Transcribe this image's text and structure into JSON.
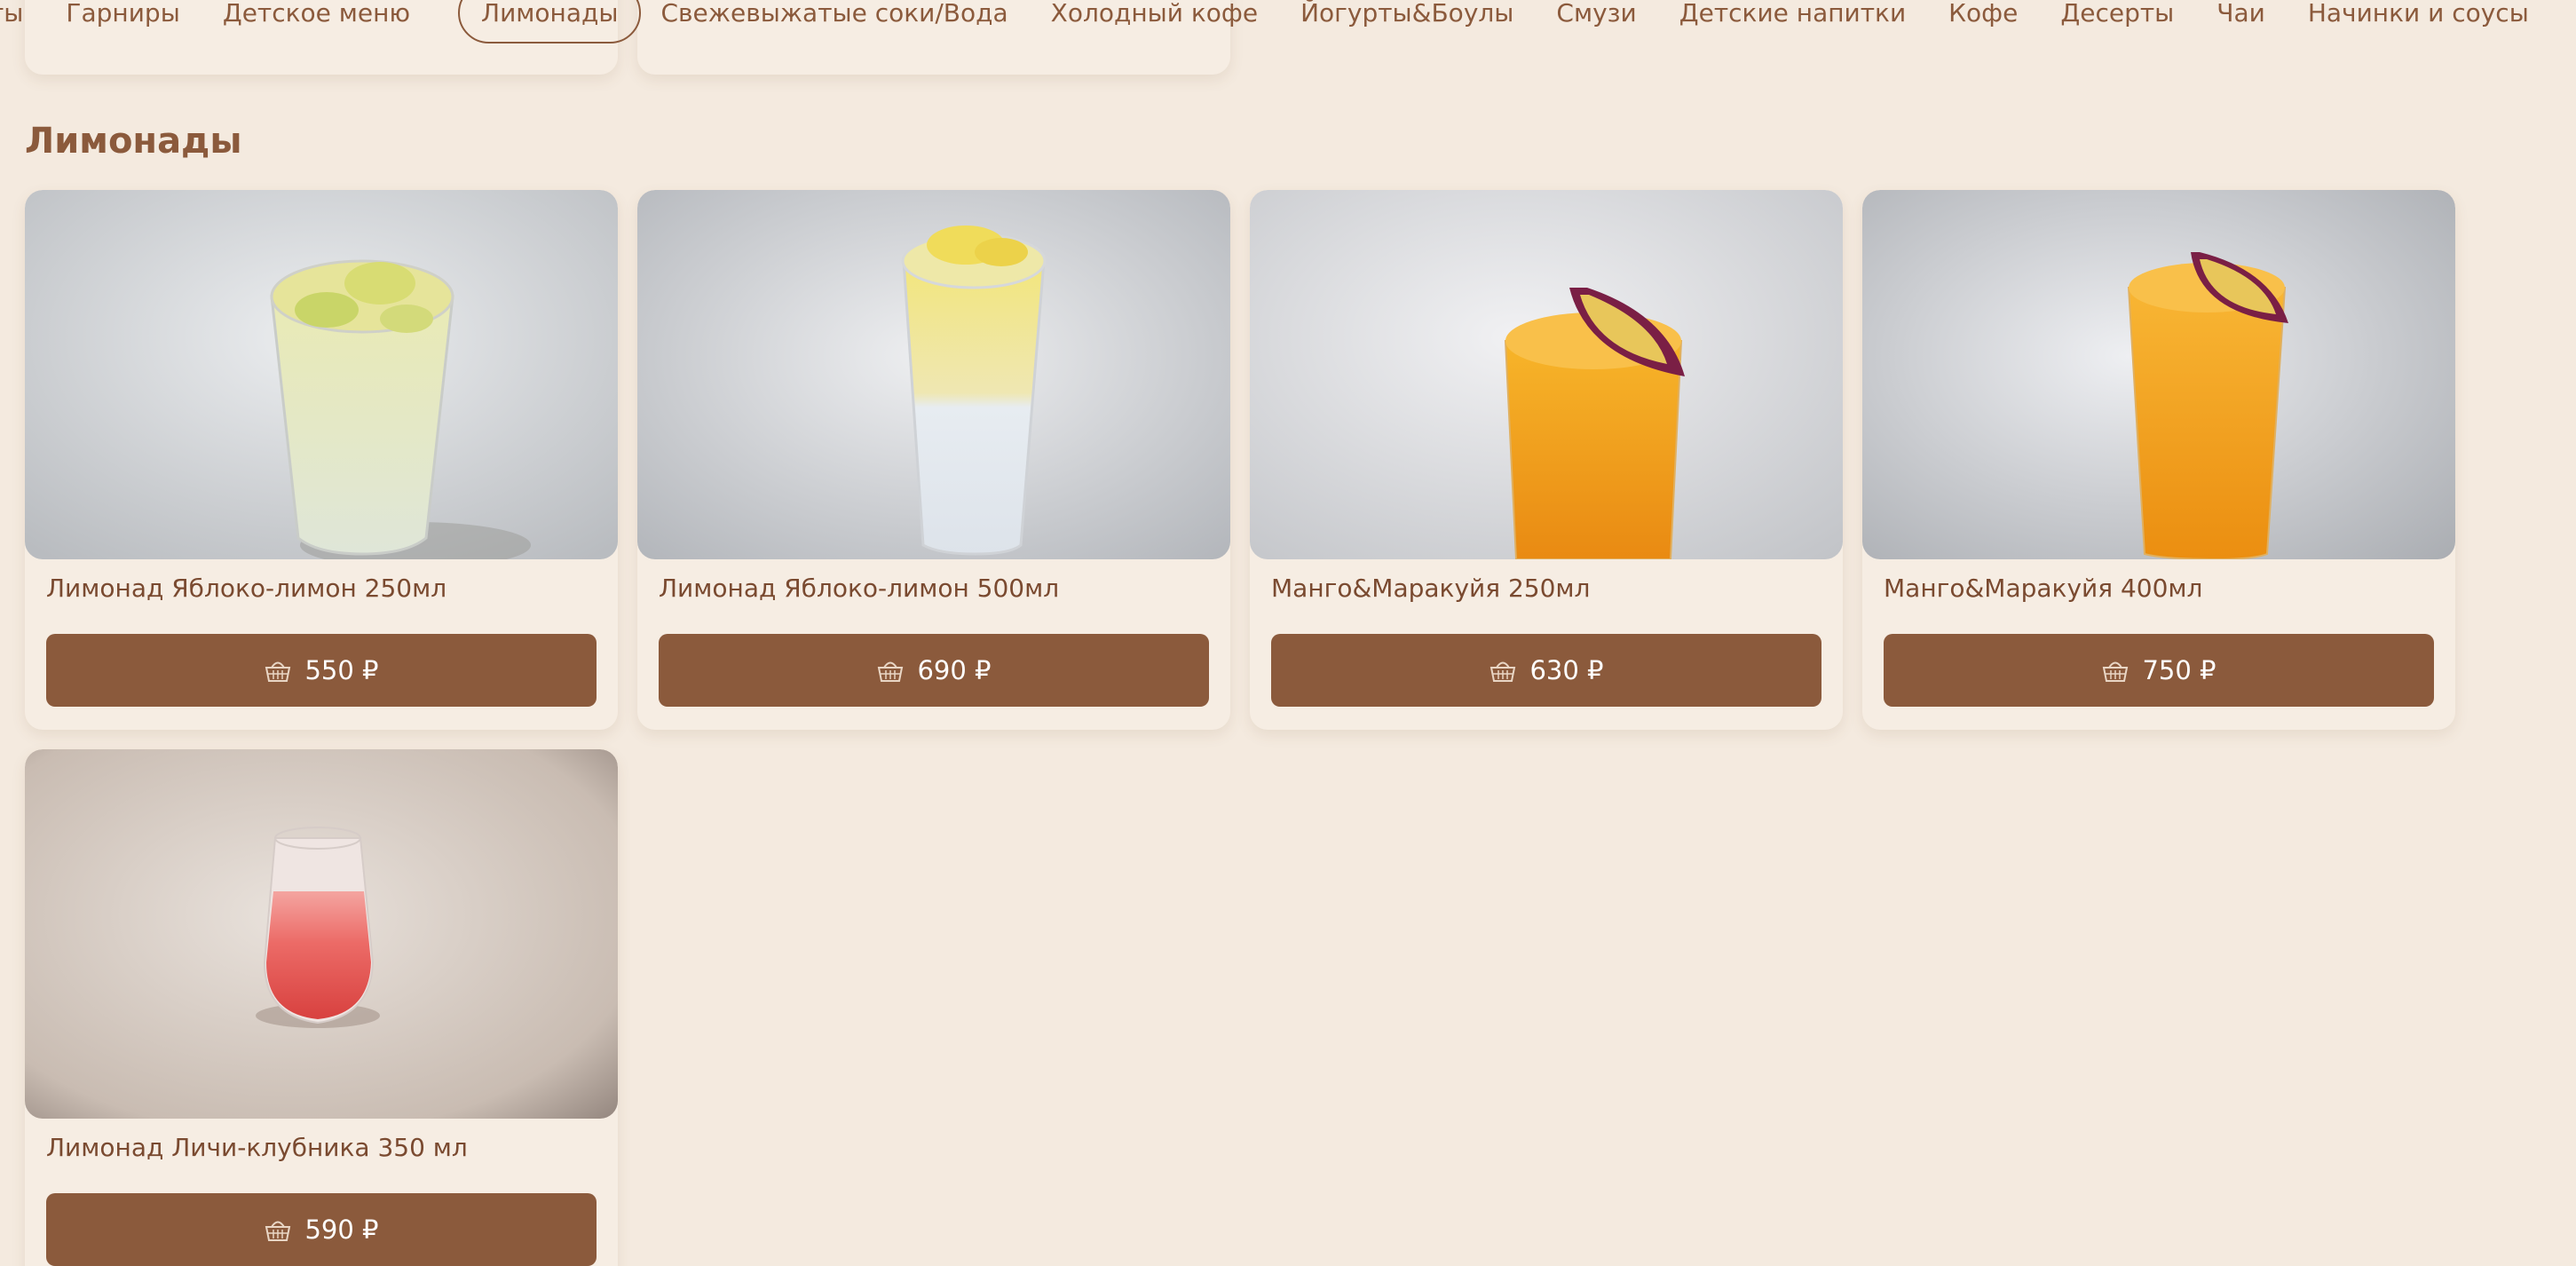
{
  "nav": {
    "categories": [
      {
        "label": "ты",
        "active": false
      },
      {
        "label": "Гарниры",
        "active": false
      },
      {
        "label": "Детское меню",
        "active": false
      },
      {
        "label": "Лимонады",
        "active": true
      },
      {
        "label": "Свежевыжатые соки/Вода",
        "active": false
      },
      {
        "label": "Холодный кофе",
        "active": false
      },
      {
        "label": "Йогурты&Боулы",
        "active": false
      },
      {
        "label": "Смузи",
        "active": false
      },
      {
        "label": "Детские напитки",
        "active": false
      },
      {
        "label": "Кофе",
        "active": false
      },
      {
        "label": "Десерты",
        "active": false
      },
      {
        "label": "Чаи",
        "active": false
      },
      {
        "label": "Начинки и соусы",
        "active": false
      }
    ]
  },
  "section": {
    "title": "Лимонады"
  },
  "products": [
    {
      "name": "Лимонад Яблоко-лимон 250мл",
      "price": "550 ₽",
      "image_icon": "lemonade-apple-lemon-icon"
    },
    {
      "name": "Лимонад Яблоко-лимон 500мл",
      "price": "690 ₽",
      "image_icon": "lemonade-apple-lemon-icon"
    },
    {
      "name": "Манго&Маракуйя 250мл",
      "price": "630 ₽",
      "image_icon": "mango-passionfruit-drink-icon"
    },
    {
      "name": "Манго&Маракуйя 400мл",
      "price": "750 ₽",
      "image_icon": "mango-passionfruit-drink-icon"
    },
    {
      "name": "Лимонад Личи-клубника 350 мл",
      "price": "590 ₽",
      "image_icon": "lychee-strawberry-drink-icon"
    }
  ],
  "colors": {
    "background": "#f4eadf",
    "card": "#f6ede3",
    "accent": "#8b5a3c",
    "text": "#7a4a30"
  },
  "icons": {
    "price_button": "basket-icon"
  }
}
